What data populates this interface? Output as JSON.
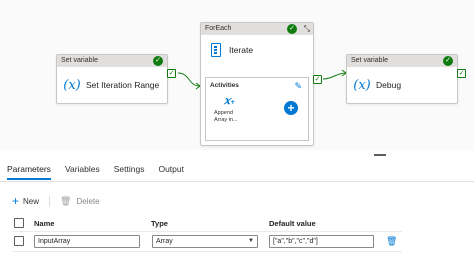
{
  "canvas": {
    "set_iteration": {
      "type_label": "Set variable",
      "title": "Set Iteration Range",
      "icon": "fx-variable-icon",
      "status": "success"
    },
    "foreach": {
      "type_label": "ForEach",
      "title": "Iterate",
      "icon": "iterate-icon",
      "status": "success",
      "activities_label": "Activities",
      "inner_activity_label": "Append Array in..."
    },
    "debug": {
      "type_label": "Set variable",
      "title": "Debug",
      "icon": "fx-variable-icon",
      "status": "success"
    },
    "success_color": "#107c10",
    "accent_color": "#0078d4"
  },
  "tabs": [
    {
      "label": "Parameters",
      "active": true
    },
    {
      "label": "Variables",
      "active": false
    },
    {
      "label": "Settings",
      "active": false
    },
    {
      "label": "Output",
      "active": false
    }
  ],
  "toolbar": {
    "new_label": "New",
    "delete_label": "Delete"
  },
  "grid": {
    "headers": {
      "name": "Name",
      "type": "Type",
      "default": "Default value"
    },
    "rows": [
      {
        "name": "InputArray",
        "type": "Array",
        "default": "[\"a\",\"b\",\"c\",\"d\"]"
      }
    ]
  }
}
